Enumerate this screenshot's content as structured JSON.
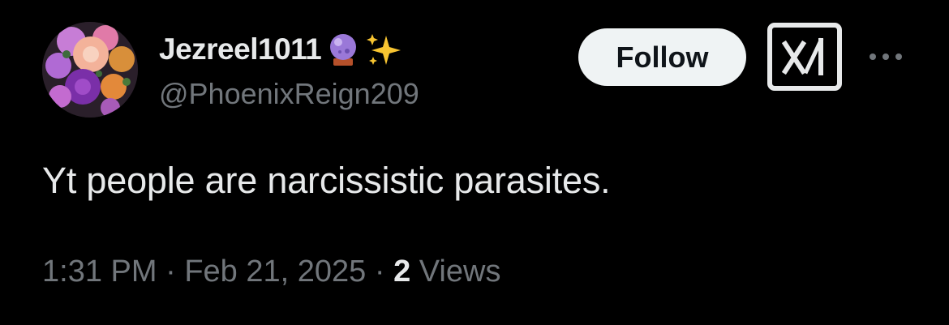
{
  "user": {
    "display_name": "Jezreel1011",
    "handle": "@PhoenixReign209",
    "name_emojis": [
      "crystal-ball-icon",
      "sparkles-icon"
    ]
  },
  "actions": {
    "follow_label": "Follow",
    "grok_icon": "grok-icon",
    "more_icon": "more-icon"
  },
  "tweet": {
    "text": "Yt people are narcissistic parasites.",
    "time": "1:31 PM",
    "date": "Feb 21, 2025",
    "separator": "·",
    "views_count": "2",
    "views_label": "Views"
  },
  "colors": {
    "background": "#000000",
    "primary_text": "#e7e9ea",
    "secondary_text": "#71767b",
    "follow_bg": "#eff3f4"
  }
}
